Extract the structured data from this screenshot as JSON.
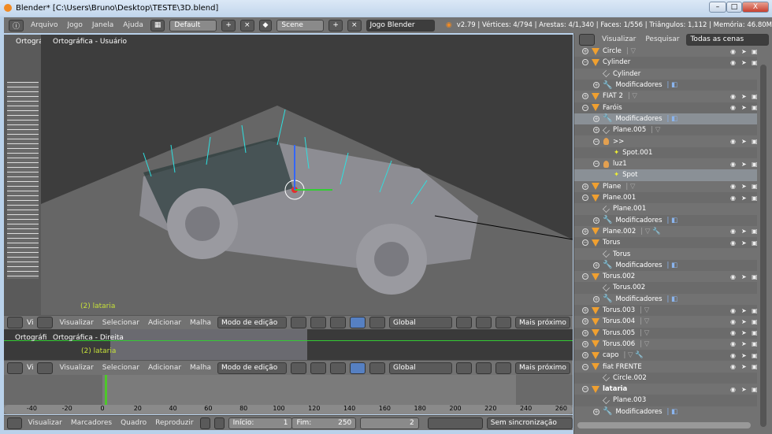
{
  "window": {
    "title": "Blender* [C:\\Users\\Bruno\\Desktop\\TESTE\\3D.blend]",
    "min": "–",
    "max": "□",
    "close": "X"
  },
  "header": {
    "menus": [
      "Arquivo",
      "Jogo",
      "Janela",
      "Ajuda"
    ],
    "layout": "Default",
    "scene": "Scene",
    "engine": "Jogo Blender",
    "stats": "v2.79 | Vértices: 4/794 | Arestas: 4/1,340 | Faces: 1/556 | Triângulos: 1,112 | Memória: 46.80M"
  },
  "viewport_main": {
    "label": "Ortográfica - Usuário",
    "object": "(2) lataria",
    "side_label": "Ortográfi"
  },
  "viewport_bottom": {
    "label": "Ortográfica - Direita",
    "object": "(2) lataria",
    "side_label": "Ortográfi"
  },
  "view_header": {
    "menus": [
      "Visualizar",
      "Selecionar",
      "Adicionar",
      "Malha"
    ],
    "mode": "Modo de edição",
    "orientation": "Global",
    "snap": "Mais próximo",
    "side_menu": "Vi"
  },
  "timeline": {
    "ticks": [
      "-40",
      "-20",
      "0",
      "20",
      "40",
      "60",
      "80",
      "100",
      "120",
      "140",
      "160",
      "180",
      "200",
      "220",
      "240",
      "260"
    ],
    "current_frame": 2,
    "menus": [
      "Visualizar",
      "Marcadores",
      "Quadro",
      "Reproduzir"
    ],
    "start_label": "Início:",
    "start": "1",
    "end_label": "Fim:",
    "end": "250",
    "frame": "2",
    "sync": "Sem sincronização"
  },
  "outliner": {
    "menus": [
      "Visualizar",
      "Pesquisar"
    ],
    "filter": "Todas as cenas",
    "rows": [
      {
        "n": "Circle",
        "lvl": 0,
        "t": "obj",
        "x": "mesh-dim",
        "vis": true
      },
      {
        "n": "Cylinder",
        "lvl": 0,
        "t": "obj",
        "open": true,
        "vis": true
      },
      {
        "n": "Cylinder",
        "lvl": 1,
        "t": "mesh"
      },
      {
        "n": "Modificadores",
        "lvl": 1,
        "t": "mod"
      },
      {
        "n": "FIAT 2",
        "lvl": 0,
        "t": "obj",
        "x": "mesh-dim",
        "vis": true
      },
      {
        "n": "Faróis",
        "lvl": 0,
        "t": "obj",
        "open": true,
        "vis": true
      },
      {
        "n": "Modificadores",
        "lvl": 1,
        "t": "mod",
        "sel": true
      },
      {
        "n": "Plane.005",
        "lvl": 1,
        "t": "mesh",
        "x": "material"
      },
      {
        "n": ">>",
        "lvl": 1,
        "t": "lamp",
        "open": true,
        "vis": true
      },
      {
        "n": "Spot.001",
        "lvl": 2,
        "t": "spot"
      },
      {
        "n": "luz1",
        "lvl": 1,
        "t": "lamp",
        "open": true,
        "vis": true
      },
      {
        "n": "Spot",
        "lvl": 2,
        "t": "spot",
        "sel": true
      },
      {
        "n": "Plane",
        "lvl": 0,
        "t": "obj",
        "x": "mesh-dim",
        "vis": true
      },
      {
        "n": "Plane.001",
        "lvl": 0,
        "t": "obj",
        "open": true,
        "vis": true
      },
      {
        "n": "Plane.001",
        "lvl": 1,
        "t": "mesh"
      },
      {
        "n": "Modificadores",
        "lvl": 1,
        "t": "mod"
      },
      {
        "n": "Plane.002",
        "lvl": 0,
        "t": "obj",
        "x": "mesh-wrench",
        "vis": true
      },
      {
        "n": "Torus",
        "lvl": 0,
        "t": "obj",
        "open": true,
        "vis": true
      },
      {
        "n": "Torus",
        "lvl": 1,
        "t": "mesh"
      },
      {
        "n": "Modificadores",
        "lvl": 1,
        "t": "mod"
      },
      {
        "n": "Torus.002",
        "lvl": 0,
        "t": "obj",
        "open": true,
        "vis": true
      },
      {
        "n": "Torus.002",
        "lvl": 1,
        "t": "mesh"
      },
      {
        "n": "Modificadores",
        "lvl": 1,
        "t": "mod"
      },
      {
        "n": "Torus.003",
        "lvl": 0,
        "t": "obj",
        "x": "mesh-dim",
        "vis": true
      },
      {
        "n": "Torus.004",
        "lvl": 0,
        "t": "obj",
        "x": "mesh-dim",
        "vis": true
      },
      {
        "n": "Torus.005",
        "lvl": 0,
        "t": "obj",
        "x": "mesh-dim",
        "vis": true
      },
      {
        "n": "Torus.006",
        "lvl": 0,
        "t": "obj",
        "x": "mesh-dim",
        "vis": true
      },
      {
        "n": "capo",
        "lvl": 0,
        "t": "obj",
        "x": "mesh-wrench",
        "vis": true
      },
      {
        "n": "fiat FRENTE",
        "lvl": 0,
        "t": "obj",
        "open": true,
        "vis": true
      },
      {
        "n": "Circle.002",
        "lvl": 1,
        "t": "mesh"
      },
      {
        "n": "lataria",
        "lvl": 0,
        "t": "obj",
        "open": true,
        "vis": true,
        "active": true
      },
      {
        "n": "Plane.003",
        "lvl": 1,
        "t": "mesh"
      },
      {
        "n": "Modificadores",
        "lvl": 1,
        "t": "mod"
      }
    ]
  },
  "colors": {
    "accent": "#f08a24",
    "selection": "#5680c2",
    "frame_line": "#4ec72a",
    "object_label": "#c6e03a"
  }
}
